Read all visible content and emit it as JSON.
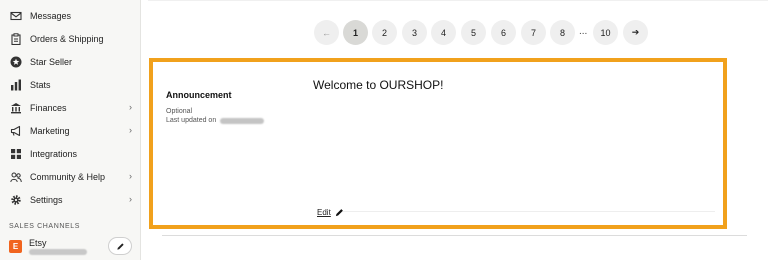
{
  "sidebar": {
    "items": [
      {
        "label": "Messages",
        "icon": "envelope-icon",
        "chevron": ""
      },
      {
        "label": "Orders & Shipping",
        "icon": "clipboard-icon",
        "chevron": ""
      },
      {
        "label": "Star Seller",
        "icon": "star-badge-icon",
        "chevron": ""
      },
      {
        "label": "Stats",
        "icon": "bar-chart-icon",
        "chevron": ""
      },
      {
        "label": "Finances",
        "icon": "bank-icon",
        "chevron": "›"
      },
      {
        "label": "Marketing",
        "icon": "megaphone-icon",
        "chevron": "›"
      },
      {
        "label": "Integrations",
        "icon": "grid-icon",
        "chevron": ""
      },
      {
        "label": "Community & Help",
        "icon": "people-icon",
        "chevron": "›"
      },
      {
        "label": "Settings",
        "icon": "gear-icon",
        "chevron": "›"
      }
    ],
    "sales_channels_title": "SALES CHANNELS",
    "channel": {
      "badge": "E",
      "name": "Etsy",
      "icon": "pencil-icon"
    }
  },
  "pagination": {
    "prev": "←",
    "pages": [
      "1",
      "2",
      "3",
      "4",
      "5",
      "6",
      "7",
      "8"
    ],
    "current": "1",
    "ellipsis": "...",
    "last": "10",
    "next": "➔"
  },
  "announcement": {
    "heading": "Announcement",
    "optional": "Optional",
    "last_updated": "Last updated on",
    "message": "Welcome to OURSHOP!",
    "edit_label": "Edit",
    "edit_icon": "pencil-icon"
  },
  "colors": {
    "highlight": "#f1a11c",
    "etsy_orange": "#f1641e",
    "sidebar_bg": "#f7f7f5"
  }
}
